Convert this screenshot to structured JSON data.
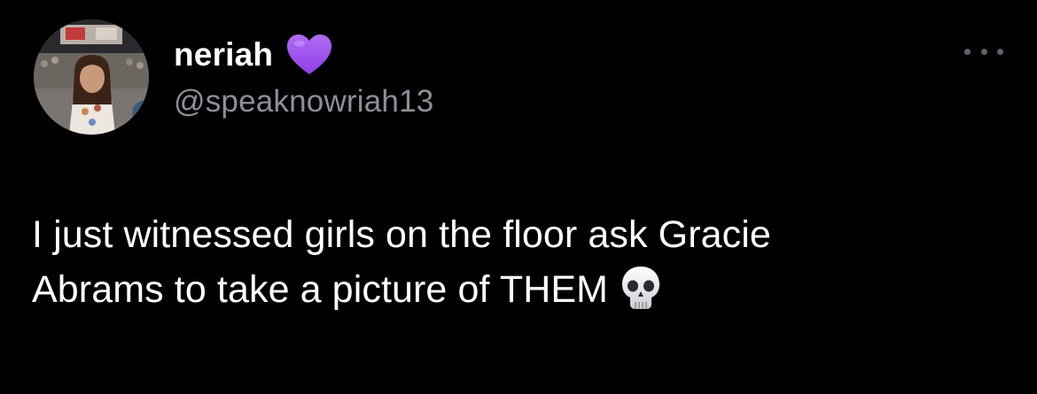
{
  "user": {
    "display_name": "neriah",
    "handle": "@speaknowriah13",
    "badge_icon": "purple-heart-icon",
    "badge_color": "#a35bf2"
  },
  "tweet": {
    "line1": "I just witnessed girls on the floor ask Gracie",
    "line2": "Abrams to take a picture of THEM",
    "trailing_icon": "skull-emoji-icon"
  },
  "menu": {
    "icon": "more-options-icon"
  },
  "colors": {
    "background": "#000000",
    "text_primary": "#ffffff",
    "text_secondary": "#8b9097"
  }
}
